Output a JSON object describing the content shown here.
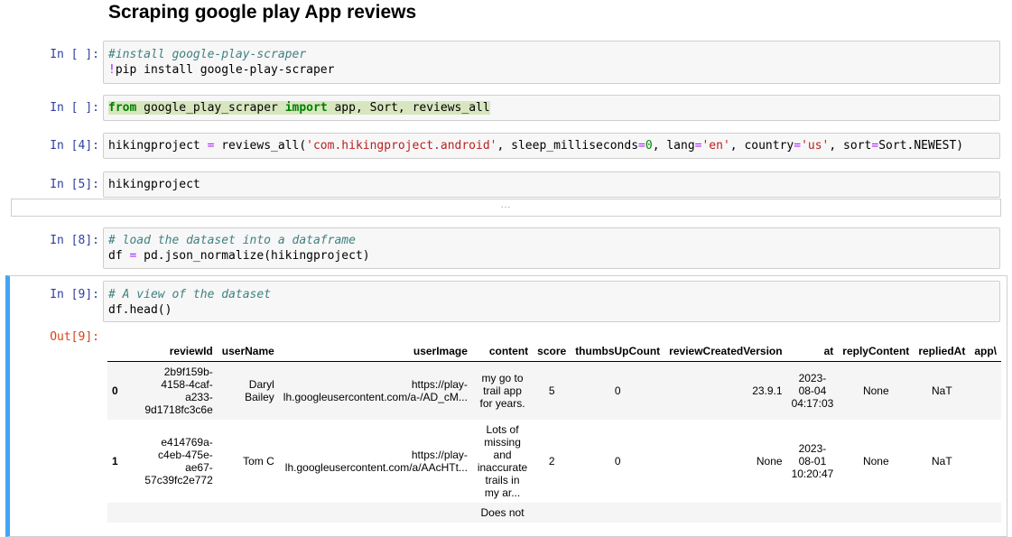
{
  "markdown": {
    "title": "Scraping google play App reviews"
  },
  "cells": {
    "c1": {
      "prompt": "In [ ]:",
      "comment": "#install google-play-scraper",
      "bang": "!",
      "cmd": "pip install google-play-scraper"
    },
    "c2": {
      "prompt": "In [ ]:",
      "kw_from": "from",
      "module": " google_play_scraper ",
      "kw_import": "import",
      "names": " app, Sort, reviews_all"
    },
    "c3": {
      "prompt": "In [4]:",
      "lhs": "hikingproject ",
      "eq": "=",
      "call": " reviews_all(",
      "s1": "'com.hikingproject.android'",
      "mid1": ", sleep_milliseconds",
      "eq2": "=",
      "n0": "0",
      "mid2": ", lang",
      "eq3": "=",
      "s2": "'en'",
      "mid3": ", country",
      "eq4": "=",
      "s3": "'us'",
      "mid4": ", sort",
      "eq5": "=",
      "tail": "Sort.NEWEST)"
    },
    "c4": {
      "prompt": "In [5]:",
      "code": "hikingproject",
      "collapsed": "..."
    },
    "c5": {
      "prompt": "In [8]:",
      "comment": "# load the dataset into a dataframe",
      "lhs": "df ",
      "eq": "=",
      "rhs": " pd.json_normalize(hikingproject)"
    },
    "c6": {
      "prompt": "In [9]:",
      "comment": "# A view of the dataset",
      "code": "df.head()",
      "out_prompt": "Out[9]:"
    }
  },
  "dataframe": {
    "columns": [
      "",
      "reviewId",
      "userName",
      "userImage",
      "content",
      "score",
      "thumbsUpCount",
      "reviewCreatedVersion",
      "at",
      "replyContent",
      "repliedAt",
      "app\\"
    ],
    "rows": [
      {
        "idx": "0",
        "reviewId": "2b9f159b-\n4158-4caf-\na233-\n9d1718fc3c6e",
        "userName": "Daryl\nBailey",
        "userImage": "https://play-\nlh.googleusercontent.com/a-/AD_cM...",
        "content": "my go to\ntrail app\nfor years.",
        "score": "5",
        "thumbsUpCount": "0",
        "reviewCreatedVersion": "23.9.1",
        "at": "2023-\n08-04\n04:17:03",
        "replyContent": "None",
        "repliedAt": "NaT"
      },
      {
        "idx": "1",
        "reviewId": "e414769a-\nc4eb-475e-\nae67-\n57c39fc2e772",
        "userName": "Tom C",
        "userImage": "https://play-\nlh.googleusercontent.com/a/AAcHTt...",
        "content": "Lots of\nmissing\nand\ninaccurate\ntrails in\nmy ar...",
        "score": "2",
        "thumbsUpCount": "0",
        "reviewCreatedVersion": "None",
        "at": "2023-\n08-01\n10:20:47",
        "replyContent": "None",
        "repliedAt": "NaT"
      },
      {
        "idx": "",
        "reviewId": "",
        "userName": "",
        "userImage": "",
        "content": "Does not",
        "score": "",
        "thumbsUpCount": "",
        "reviewCreatedVersion": "",
        "at": "",
        "replyContent": "",
        "repliedAt": ""
      }
    ]
  }
}
